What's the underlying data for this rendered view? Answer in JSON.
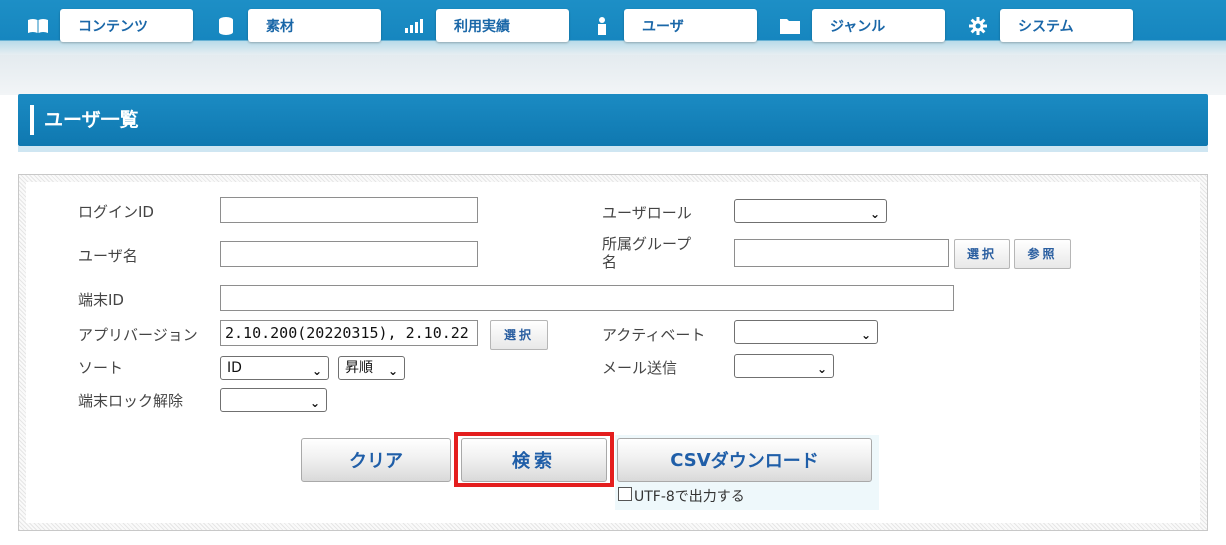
{
  "nav": {
    "items": [
      {
        "label": "コンテンツ",
        "icon": "book-icon"
      },
      {
        "label": "素材",
        "icon": "database-icon"
      },
      {
        "label": "利用実績",
        "icon": "bar-chart-icon"
      },
      {
        "label": "ユーザ",
        "icon": "user-icon"
      },
      {
        "label": "ジャンル",
        "icon": "folder-icon"
      },
      {
        "label": "システム",
        "icon": "gear-icon"
      }
    ]
  },
  "page": {
    "title": "ユーザ一覧"
  },
  "form": {
    "login_id": {
      "label": "ログインID",
      "value": ""
    },
    "user_name": {
      "label": "ユーザ名",
      "value": ""
    },
    "device_id": {
      "label": "端末ID",
      "value": ""
    },
    "app_version": {
      "label": "アプリバージョン",
      "value": "2.10.200(20220315), 2.10.22",
      "select_label": "選択"
    },
    "sort": {
      "label": "ソート",
      "field_value": "ID",
      "order_value": "昇順"
    },
    "device_unlock": {
      "label": "端末ロック解除",
      "value": ""
    },
    "user_role": {
      "label": "ユーザロール",
      "value": ""
    },
    "group": {
      "label_line1": "所属グループ",
      "label_line2": "名",
      "value": "",
      "select_label": "選択",
      "browse_label": "参照"
    },
    "activate": {
      "label": "アクティベート",
      "value": ""
    },
    "mail": {
      "label": "メール送信",
      "value": ""
    }
  },
  "buttons": {
    "clear": "クリア",
    "search": "検索",
    "csv_prefix": "CSV",
    "csv_suffix": "ダウンロード",
    "utf8_label": "UTF-8で出力する",
    "utf8_checked": false
  },
  "colors": {
    "nav": "#1686bf",
    "highlight": "#e41e1e",
    "button_text": "#1f5ea8"
  }
}
